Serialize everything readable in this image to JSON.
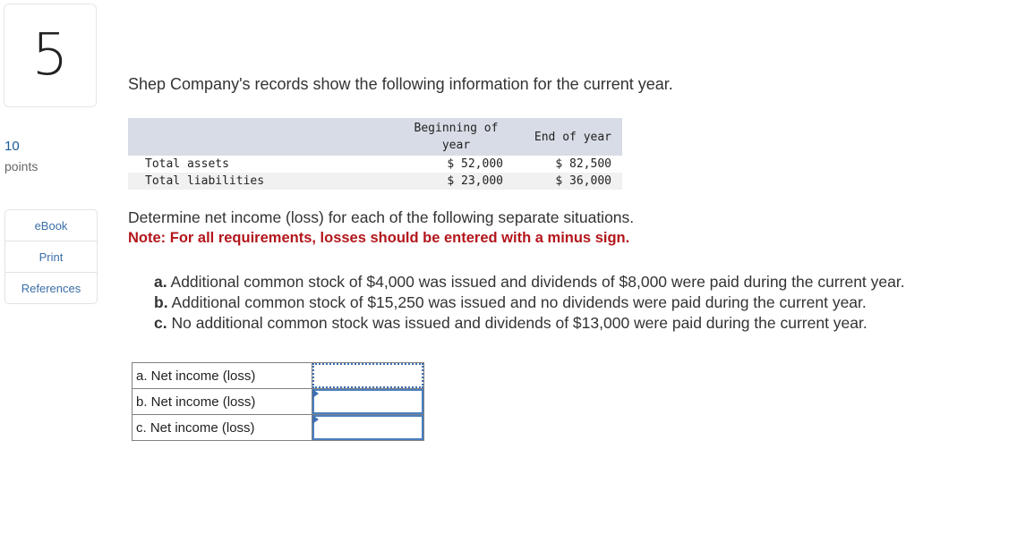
{
  "question": {
    "number": "5",
    "points_value": "10",
    "points_label": "points"
  },
  "side_links": [
    {
      "label": "eBook"
    },
    {
      "label": "Print"
    },
    {
      "label": "References"
    }
  ],
  "intro": "Shep Company's records show the following information for the current year.",
  "info_table": {
    "headers": {
      "label": "",
      "beginning": "Beginning of year",
      "end": "End of year"
    },
    "rows": [
      {
        "label": "Total assets",
        "beginning": "$ 52,000",
        "end": "$ 82,500"
      },
      {
        "label": "Total liabilities",
        "beginning": "$ 23,000",
        "end": "$ 36,000"
      }
    ]
  },
  "instruction": "Determine net income (loss) for each of the following separate situations.",
  "note": "Note: For all requirements, losses should be entered with a minus sign.",
  "situations": [
    {
      "letter": "a.",
      "text": "Additional common stock of $4,000 was issued and dividends of $8,000 were paid during the current year."
    },
    {
      "letter": "b.",
      "text": "Additional common stock of $15,250 was issued and no dividends were paid during the current year."
    },
    {
      "letter": "c.",
      "text": "No additional common stock was issued and dividends of $13,000 were paid during the current year."
    }
  ],
  "answers": [
    {
      "label": "a. Net income (loss)",
      "value": ""
    },
    {
      "label": "b. Net income (loss)",
      "value": ""
    },
    {
      "label": "c. Net income (loss)",
      "value": ""
    }
  ]
}
